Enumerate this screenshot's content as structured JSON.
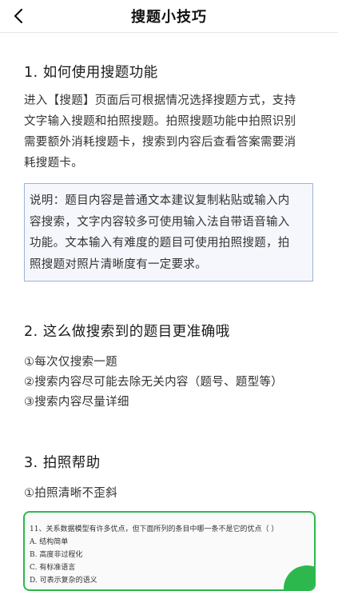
{
  "navbar": {
    "title": "搜题小技巧"
  },
  "sections": [
    {
      "title": "1. 如何使用搜题功能",
      "paragraph_lines": [
        "进入【搜题】页面后可根据情况选择搜题方式，支持",
        "文字输入搜题和拍照搜题。拍照搜题功能中拍照识别",
        "需要额外消耗搜题卡，搜索到内容后查看答案需要消",
        "耗搜题卡。"
      ],
      "note_lines": [
        "说明：题目内容是普通文本建议复制粘贴或输入内",
        "容搜索，文字内容较多可使用输入法自带语音输入",
        "功能。文本输入有难度的题目可使用拍照搜题，拍",
        "照搜题对照片清晰度有一定要求。"
      ]
    },
    {
      "title": "2. 这么做搜索到的题目更准确哦",
      "items": [
        "①每次仅搜索一题",
        "②搜索内容尽可能去除无关内容（题号、题型等）",
        "③搜索内容尽量详细"
      ]
    },
    {
      "title": "3. 拍照帮助",
      "items": [
        "①拍照清晰不歪斜"
      ]
    }
  ],
  "example_photo": {
    "lines": [
      "11、关系数据模型有许多优点，但下面所列的条目中哪一条不是它的优点（      ）",
      "A. 结构简单",
      "B. 高度非过程化",
      "C. 有标准语言",
      "D. 可表示复杂的语义"
    ]
  },
  "colors": {
    "accent_green": "#2db84d",
    "note_border": "#9fb2d6"
  }
}
